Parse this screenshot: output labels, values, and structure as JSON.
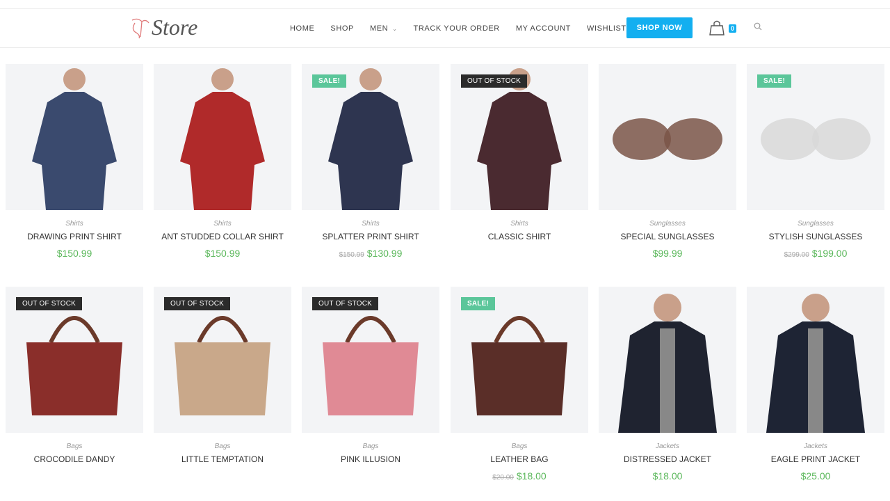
{
  "header": {
    "logo": "Store",
    "nav": [
      {
        "label": "HOME"
      },
      {
        "label": "SHOP"
      },
      {
        "label": "MEN",
        "dropdown": true
      },
      {
        "label": "TRACK YOUR ORDER"
      },
      {
        "label": "MY ACCOUNT"
      },
      {
        "label": "WISHLIST"
      }
    ],
    "cta": "SHOP NOW",
    "cart_count": "0",
    "accent": "#13aff0"
  },
  "products": [
    {
      "category": "Shirts",
      "name": "DRAWING PRINT SHIRT",
      "price": "$150.99",
      "badge": "",
      "image": "shirt",
      "color": "#3a4a6e"
    },
    {
      "category": "Shirts",
      "name": "ANT STUDDED COLLAR SHIRT",
      "price": "$150.99",
      "badge": "",
      "image": "shirt",
      "color": "#b02a2a"
    },
    {
      "category": "Shirts",
      "name": "SPLATTER PRINT SHIRT",
      "old_price": "$150.99",
      "price": "$130.99",
      "badge": "SALE!",
      "image": "shirt",
      "color": "#2e3550"
    },
    {
      "category": "Shirts",
      "name": "CLASSIC SHIRT",
      "price": "",
      "badge": "OUT OF STOCK",
      "image": "shirt",
      "color": "#4a2a30"
    },
    {
      "category": "Sunglasses",
      "name": "SPECIAL SUNGLASSES",
      "price": "$99.99",
      "badge": "",
      "image": "glasses",
      "color": "#7a5548"
    },
    {
      "category": "Sunglasses",
      "name": "STYLISH SUNGLASSES",
      "old_price": "$299.00",
      "price": "$199.00",
      "badge": "SALE!",
      "image": "glasses",
      "color": "#d8d8d8"
    },
    {
      "category": "Bags",
      "name": "CROCODILE DANDY",
      "price": "",
      "badge": "OUT OF STOCK",
      "image": "bag",
      "color": "#8a2e2a"
    },
    {
      "category": "Bags",
      "name": "LITTLE TEMPTATION",
      "price": "",
      "badge": "OUT OF STOCK",
      "image": "bag",
      "color": "#c9a88a"
    },
    {
      "category": "Bags",
      "name": "PINK ILLUSION",
      "price": "",
      "badge": "OUT OF STOCK",
      "image": "bag",
      "color": "#e08a95"
    },
    {
      "category": "Bags",
      "name": "LEATHER BAG",
      "old_price": "$20.00",
      "price": "$18.00",
      "badge": "SALE!",
      "image": "bag",
      "color": "#5a2e28"
    },
    {
      "category": "Jackets",
      "name": "DISTRESSED JACKET",
      "price": "$18.00",
      "badge": "",
      "image": "jacket",
      "color": "#1f2330"
    },
    {
      "category": "Jackets",
      "name": "EAGLE PRINT JACKET",
      "price": "$25.00",
      "badge": "",
      "image": "jacket",
      "color": "#1e2434"
    }
  ],
  "colors": {
    "price": "#5cb85c",
    "sale_badge": "#5bc69a",
    "out_of_stock_badge": "#2b2b2b"
  }
}
